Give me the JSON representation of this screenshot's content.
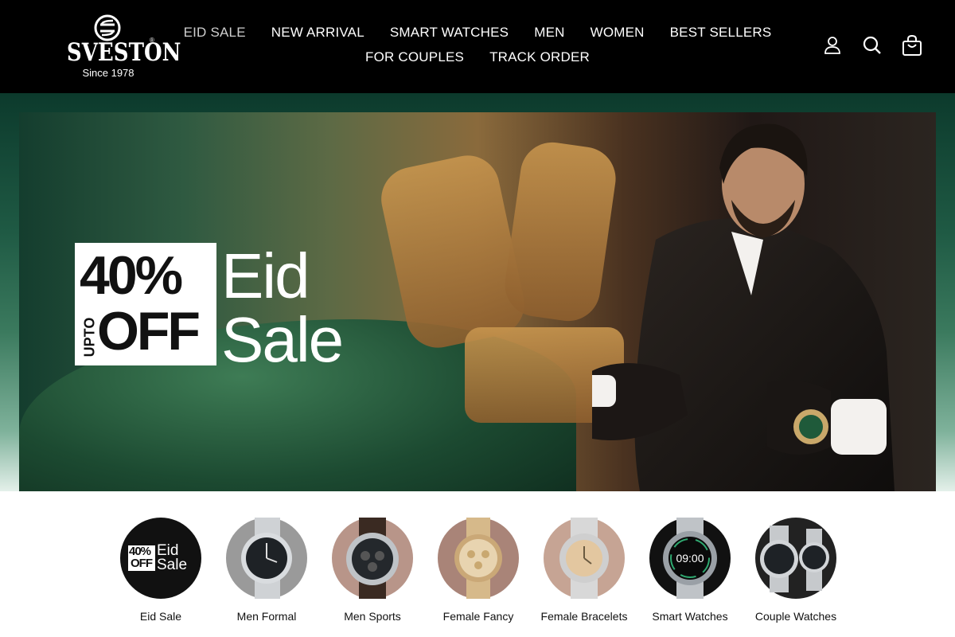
{
  "brand": {
    "name": "SVESTON",
    "tagline": "Since 1978",
    "reg": "®"
  },
  "nav": {
    "row1": [
      "EID SALE",
      "NEW ARRIVAL",
      "SMART WATCHES",
      "MEN",
      "WOMEN",
      "BEST SELLERS"
    ],
    "row2": [
      "FOR COUPLES",
      "TRACK ORDER"
    ]
  },
  "header_icons": [
    "account-icon",
    "search-icon",
    "cart-icon"
  ],
  "hero": {
    "discount": "40%",
    "off": "OFF",
    "upto": "UPTO",
    "title_line1": "Eid",
    "title_line2": "Sale"
  },
  "categories": [
    {
      "label": "Eid Sale",
      "badge_num": "40%",
      "badge_off": "OFF",
      "badge_eid": "Eid",
      "badge_sale": "Sale"
    },
    {
      "label": "Men Formal"
    },
    {
      "label": "Men Sports"
    },
    {
      "label": "Female Fancy"
    },
    {
      "label": "Female Bracelets"
    },
    {
      "label": "Smart Watches",
      "screen_time": "09:00"
    },
    {
      "label": "Couple Watches"
    }
  ],
  "colors": {
    "header_bg": "#000000",
    "hero_green": "#1f5a44",
    "text": "#111111"
  }
}
